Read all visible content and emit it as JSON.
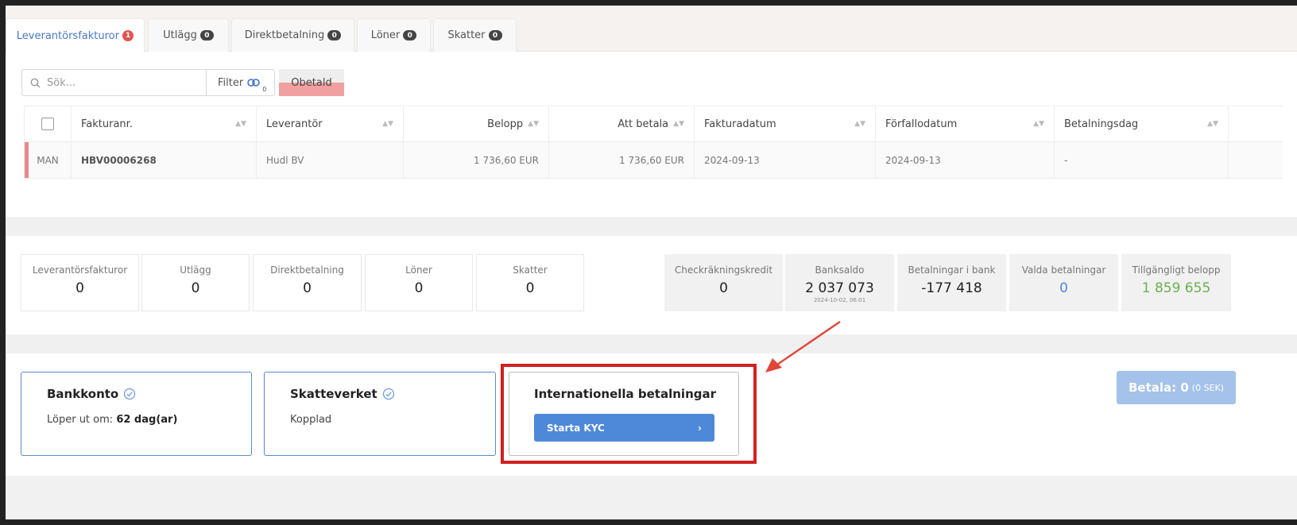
{
  "tabs": [
    {
      "label": "Leverantörsfakturor",
      "count": "1"
    },
    {
      "label": "Utlägg",
      "count": "0"
    },
    {
      "label": "Direktbetalning",
      "count": "0"
    },
    {
      "label": "Löner",
      "count": "0"
    },
    {
      "label": "Skatter",
      "count": "0"
    }
  ],
  "search": {
    "placeholder": "Sök..."
  },
  "filter": {
    "label": "Filter",
    "count": "0"
  },
  "chip": {
    "label": "Obetald"
  },
  "table": {
    "headers": [
      "Fakturanr.",
      "Leverantör",
      "Belopp",
      "Att betala",
      "Fakturadatum",
      "Förfallodatum",
      "Betalningsdag"
    ],
    "row": {
      "type": "MAN",
      "invoice": "HBV00006268",
      "supplier": "Hudl BV",
      "amount": "1 736,60 EUR",
      "to_pay": "1 736,60 EUR",
      "invoice_date": "2024-09-13",
      "due_date": "2024-09-13",
      "payment_day": "-"
    }
  },
  "summary": {
    "counts": [
      {
        "label": "Leverantörsfakturor",
        "value": "0"
      },
      {
        "label": "Utlägg",
        "value": "0"
      },
      {
        "label": "Direktbetalning",
        "value": "0"
      },
      {
        "label": "Löner",
        "value": "0"
      },
      {
        "label": "Skatter",
        "value": "0"
      }
    ],
    "checkkredit": {
      "label": "Checkräkningskredit",
      "value": "0"
    },
    "banksaldo": {
      "label": "Banksaldo",
      "value": "2 037 073",
      "date": "2024-10-02, 06:01"
    },
    "bankpay": {
      "label": "Betalningar i bank",
      "value": "-177 418"
    },
    "selected": {
      "label": "Valda betalningar",
      "value": "0"
    },
    "available": {
      "label": "Tillgängligt belopp",
      "value": "1 859 655"
    }
  },
  "cards": {
    "bank": {
      "title": "Bankkonto",
      "desc_prefix": "Löper ut om:",
      "desc_value": "62 dag(ar)"
    },
    "tax": {
      "title": "Skatteverket",
      "desc": "Kopplad"
    },
    "intl": {
      "title": "Internationella betalningar",
      "button": "Starta KYC"
    }
  },
  "pay": {
    "label": "Betala: 0",
    "sub": "(0 SEK)"
  },
  "colors": {
    "accent": "#4e88d8",
    "danger": "#d42020",
    "positive": "#6ab04c"
  }
}
